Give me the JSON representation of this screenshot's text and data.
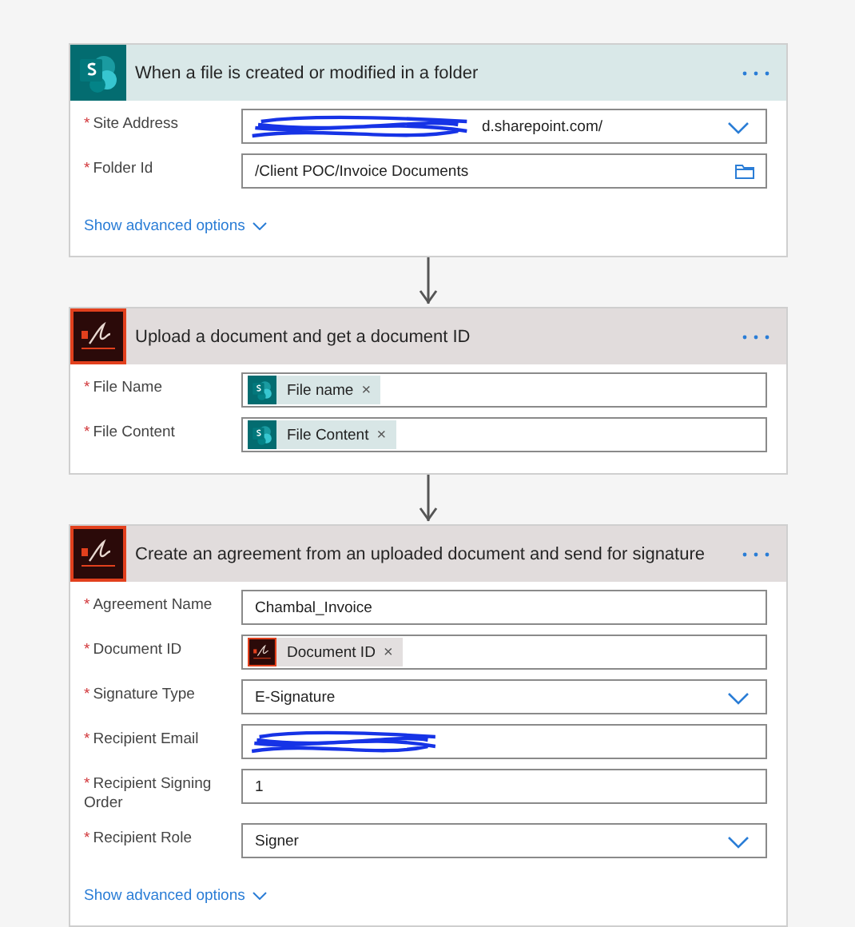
{
  "cards": [
    {
      "kind": "sharepoint",
      "title": "When a file is created or modified in a folder",
      "fields": [
        {
          "label": "Site Address",
          "marker": "*",
          "kind": "dropdown",
          "value": "d.sharepoint.com/",
          "redacted": true
        },
        {
          "label": "Folder Id",
          "marker": "*",
          "kind": "folder",
          "value": "/Client POC/Invoice Documents",
          "redacted": false
        }
      ],
      "advanced_link": "Show advanced options"
    },
    {
      "kind": "adobe-sign",
      "title": "Upload a document and get a document ID",
      "fields": [
        {
          "label": "File Name",
          "marker": "*",
          "kind": "tokens",
          "tokens": [
            {
              "label": "File name",
              "kind": "sharepoint",
              "remove": "×"
            }
          ],
          "redacted": false
        },
        {
          "label": "File Content",
          "marker": "*",
          "kind": "tokens",
          "tokens": [
            {
              "label": "File Content",
              "kind": "sharepoint",
              "remove": "×"
            }
          ],
          "redacted": false
        }
      ]
    },
    {
      "kind": "adobe-sign",
      "title": "Create an agreement from an uploaded document and send for signature",
      "fields": [
        {
          "label": "Agreement Name",
          "marker": "*",
          "kind": "text",
          "value": "Chambal_Invoice",
          "redacted": false
        },
        {
          "label": "Document ID",
          "marker": "*",
          "kind": "tokens",
          "tokens": [
            {
              "label": "Document ID",
              "kind": "adobe-sign",
              "remove": "×"
            }
          ],
          "redacted": false
        },
        {
          "label": "Signature Type",
          "marker": "*",
          "kind": "dropdown",
          "value": "E-Signature",
          "redacted": false
        },
        {
          "label": "Recipient Email",
          "marker": "*",
          "kind": "text",
          "redacted": true
        },
        {
          "label": "Recipient Signing Order",
          "marker": "*",
          "kind": "text",
          "value": "1",
          "redacted": false
        },
        {
          "label": "Recipient Role",
          "marker": "*",
          "kind": "dropdown",
          "value": "Signer",
          "redacted": false
        }
      ],
      "advanced_link": "Show advanced options"
    }
  ]
}
